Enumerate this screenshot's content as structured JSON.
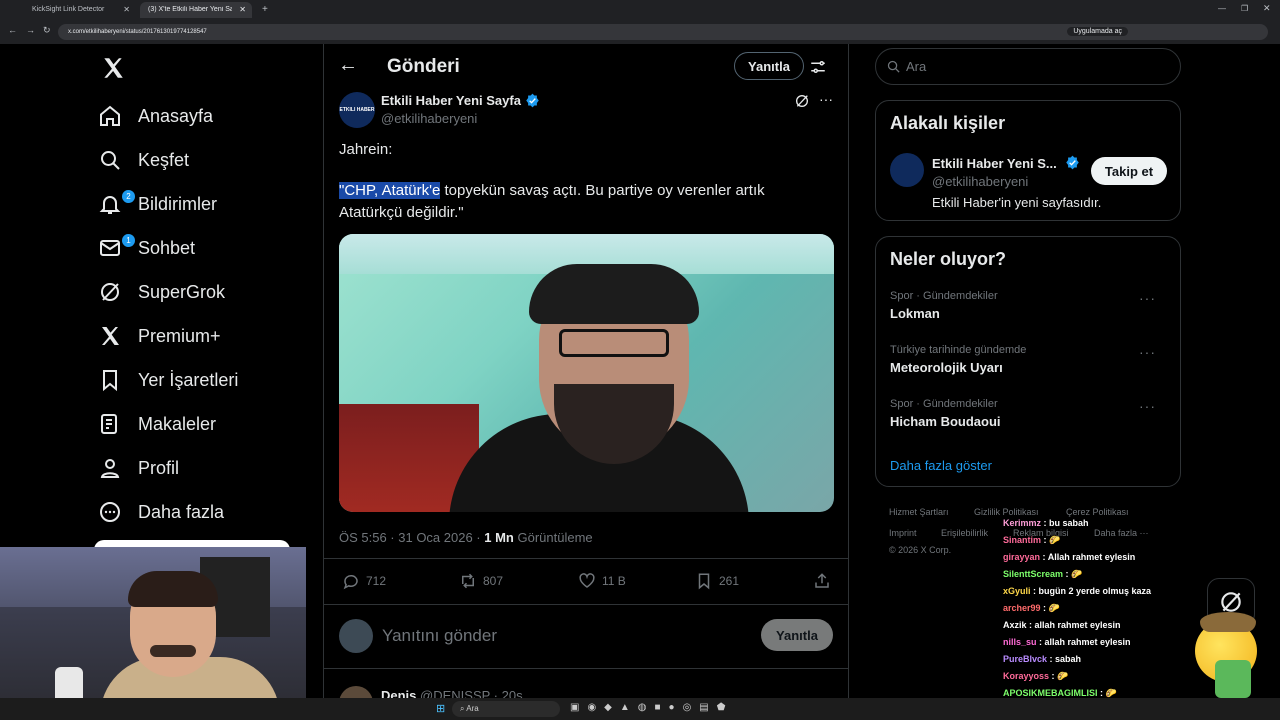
{
  "browser": {
    "tabs": [
      {
        "label": "KickSight Link Detector"
      },
      {
        "label": "(3) X'te Etkili Haber Yeni Sayfa"
      }
    ],
    "url": "x.com/etkilihaberyeni/status/2017613019774128547",
    "open_in_app": "Uygulamada aç"
  },
  "nav": {
    "items": [
      {
        "label": "Anasayfa"
      },
      {
        "label": "Keşfet"
      },
      {
        "label": "Bildirimler",
        "badge": "2"
      },
      {
        "label": "Sohbet",
        "badge": "1"
      },
      {
        "label": "SuperGrok"
      },
      {
        "label": "Premium+"
      },
      {
        "label": "Yer İşaretleri"
      },
      {
        "label": "Makaleler"
      },
      {
        "label": "Profil"
      },
      {
        "label": "Daha fazla"
      }
    ]
  },
  "header": {
    "title": "Gönderi",
    "reply_button": "Yanıtla"
  },
  "post": {
    "author_name": "Etkili Haber Yeni Sayfa",
    "handle": "@etkilihaberyeni",
    "avatar_text": "ETKILI HABER",
    "text_line1": "Jahrein:",
    "text_highlight": "\"CHP, Atatürk'e",
    "text_rest": " topyekün savaş açtı. Bu partiye oy verenler artık",
    "text_line3": "Atatürkçü değildir.\"",
    "time": "ÖS 5:56 · 31 Oca 2026 · ",
    "views_count": "1 Mn",
    "views_label": " Görüntüleme",
    "replies": "712",
    "reposts": "807",
    "likes": "11 B",
    "bookmarks": "261"
  },
  "reply_box": {
    "placeholder": "Yanıtını gönder",
    "button": "Yanıtla"
  },
  "next_post": {
    "author": "Denis",
    "handle": "@DENISSP · 20s"
  },
  "right": {
    "search_placeholder": "Ara",
    "related_title": "Alakalı kişiler",
    "related_name": "Etkili Haber Yeni S...",
    "related_handle": "@etkilihaberyeni",
    "related_bio": "Etkili Haber'in yeni sayfasıdır.",
    "follow_button": "Takip et",
    "trends_title": "Neler oluyor?",
    "trends": [
      {
        "meta": "Spor · Gündemdekiler",
        "name": "Lokman"
      },
      {
        "meta": "Türkiye tarihinde gündemde",
        "name": "Meteorolojik Uyarı"
      },
      {
        "meta": "Spor · Gündemdekiler",
        "name": "Hicham Boudaoui"
      }
    ],
    "show_more": "Daha fazla göster",
    "footer": {
      "terms": "Hizmet Şartları",
      "privacy": "Gizlilik Politikası",
      "cookie": "Çerez Politikası",
      "imprint": "Imprint",
      "accessibility": "Erişilebilirlik",
      "ads": "Reklam bilgisi",
      "more": "Daha fazla ···",
      "copyright": "© 2026 X Corp."
    }
  },
  "chat": {
    "lines": [
      {
        "user": "Kerimmz",
        "msg": " : bu sabah",
        "color": "#ff9ed8"
      },
      {
        "user": "Sinantim",
        "msg": " : 🌮",
        "color": "#ff6b9a"
      },
      {
        "user": "girayyan",
        "msg": " : Allah rahmet eylesin",
        "color": "#ff6b9a"
      },
      {
        "user": "SilenttScream",
        "msg": " : 🌮",
        "color": "#7dff6b"
      },
      {
        "user": "xGyuli",
        "msg": " : bugün 2 yerde olmuş kaza",
        "color": "#ffd84a"
      },
      {
        "user": "archer99",
        "msg": " : 🌮",
        "color": "#ff6b6b"
      },
      {
        "user": "Axzik",
        "msg": " : allah rahmet eylesin",
        "color": "#ffffff"
      },
      {
        "user": "nills_su",
        "msg": " : allah rahmet eylesin",
        "color": "#ff6bd6"
      },
      {
        "user": "PureBlvck",
        "msg": " : sabah",
        "color": "#b98cff"
      },
      {
        "user": "Korayyoss",
        "msg": " : 🌮",
        "color": "#ff6b9a"
      },
      {
        "user": "APOSIKMEBAGIMLISI",
        "msg": " : 🌮",
        "color": "#7dff6b"
      }
    ]
  },
  "taskbar": {
    "search": "Ara"
  }
}
